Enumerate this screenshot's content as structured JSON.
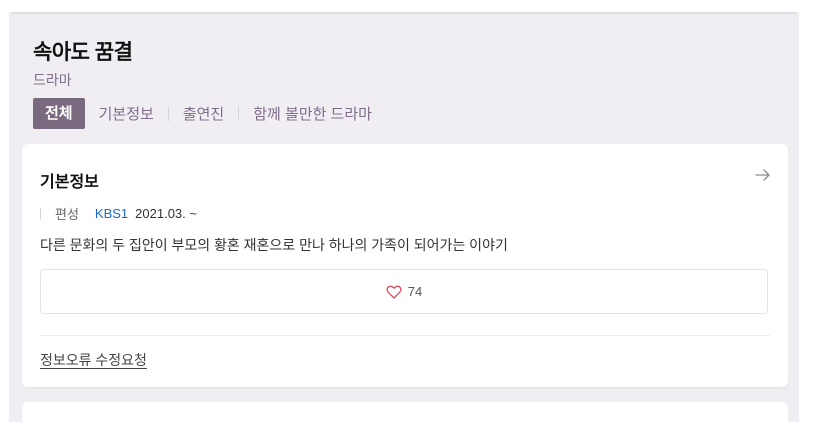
{
  "title": "속아도 꿈결",
  "genre": "드라마",
  "tabs": [
    {
      "label": "전체",
      "active": true
    },
    {
      "label": "기본정보",
      "active": false
    },
    {
      "label": "출연진",
      "active": false
    },
    {
      "label": "함께 볼만한 드라마",
      "active": false
    }
  ],
  "info_card": {
    "heading": "기본정보",
    "arrow_icon": "arrow-right-icon",
    "meta_label": "편성",
    "network": "KBS1",
    "air_date": "2021.03. ~",
    "synopsis": "다른 문화의 두 집안이 부모의 황혼 재혼으로 만나 하나의 가족이 되어가는 이야기",
    "like_icon": "heart-outline-icon",
    "like_count": "74",
    "report_link": "정보오류 수정요청"
  },
  "colors": {
    "panel_bg": "#f1eef3",
    "accent": "#7a6a80",
    "tab_text": "#7f6d8a",
    "network_link": "#1a6bc9",
    "heart": "#e0485d"
  }
}
